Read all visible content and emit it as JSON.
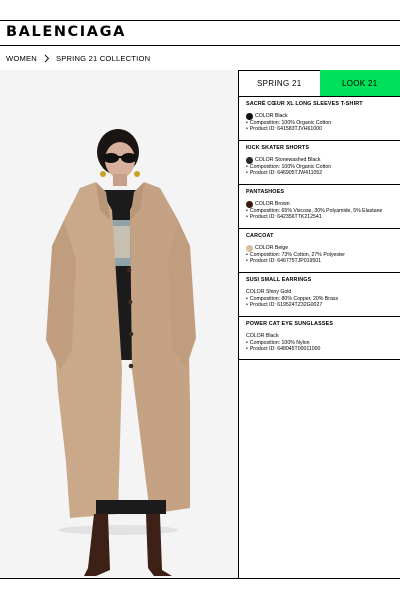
{
  "header": {
    "brand": "BALENCIAGA"
  },
  "breadcrumb": {
    "items": [
      "WOMEN",
      "SPRING 21 COLLECTION"
    ]
  },
  "tabs": [
    {
      "label": "SPRING 21",
      "active": false
    },
    {
      "label": "LOOK 21",
      "active": true,
      "color": "#00e05a"
    }
  ],
  "products": [
    {
      "name": "SACRÉ CŒUR XL LONG SLEEVES T-SHIRT",
      "color_label": "COLOR",
      "color": "Black",
      "swatch": "#111111",
      "composition": "Composition: 100% Organic Cotton",
      "product_id": "Product ID: 641583TJVH61000"
    },
    {
      "name": "KICK SKATER SHORTS",
      "color_label": "COLOR",
      "color": "Stonewashed Black",
      "swatch": "#2b2b2b",
      "composition": "Composition: 100% Organic Cotton",
      "product_id": "Product ID: 646905TJW411052"
    },
    {
      "name": "PANTASHOES",
      "color_label": "COLOR",
      "color": "Brown",
      "swatch": "#3a1d12",
      "composition": "Composition: 65% Viscose, 30% Polyamide, 5% Elastane",
      "product_id": "Product ID: 642356TTK212541"
    },
    {
      "name": "CARCOAT",
      "color_label": "COLOR",
      "color": "Beige",
      "swatch": "#d9bfa6",
      "composition": "Composition: 73% Cotton, 27% Polyester",
      "product_id": "Product ID: 646775TJP019501"
    },
    {
      "name": "SUSI SMALL EARRINGS",
      "color_label": "COLOR",
      "color": "Shiny Gold",
      "swatch": null,
      "composition": "Composition: 80% Copper, 20% Brass",
      "product_id": "Product ID: 619524TZ32G0027"
    },
    {
      "name": "POWER CAT EYE SUNGLASSES",
      "color_label": "COLOR",
      "color": "Black",
      "swatch": null,
      "composition": "Composition: 100% Nylon",
      "product_id": "Product ID: 648045T00011000"
    }
  ],
  "icons": {
    "breadcrumb_separator": "chevron-right-icon"
  }
}
